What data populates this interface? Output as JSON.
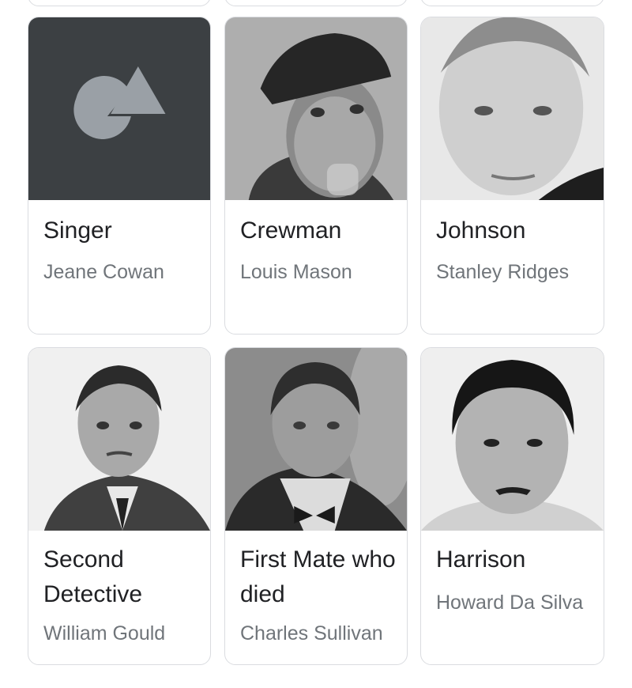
{
  "cast": [
    {
      "role": "Singer",
      "actor": "Jeane Cowan",
      "image_icon": "placeholder-shapes-icon"
    },
    {
      "role": "Crewman",
      "actor": "Louis Mason"
    },
    {
      "role": "Johnson",
      "actor": "Stanley Ridges"
    },
    {
      "role": "Second Detective",
      "actor": "William Gould"
    },
    {
      "role": "First Mate who died",
      "actor": "Charles Sullivan"
    },
    {
      "role": "Harrison",
      "actor": "Howard Da Silva"
    }
  ],
  "colors": {
    "card_border": "#dadce0",
    "role_text": "#202124",
    "actor_text": "#70757a",
    "placeholder_bg": "#3c4043",
    "placeholder_shapes": "#9aa0a6"
  }
}
